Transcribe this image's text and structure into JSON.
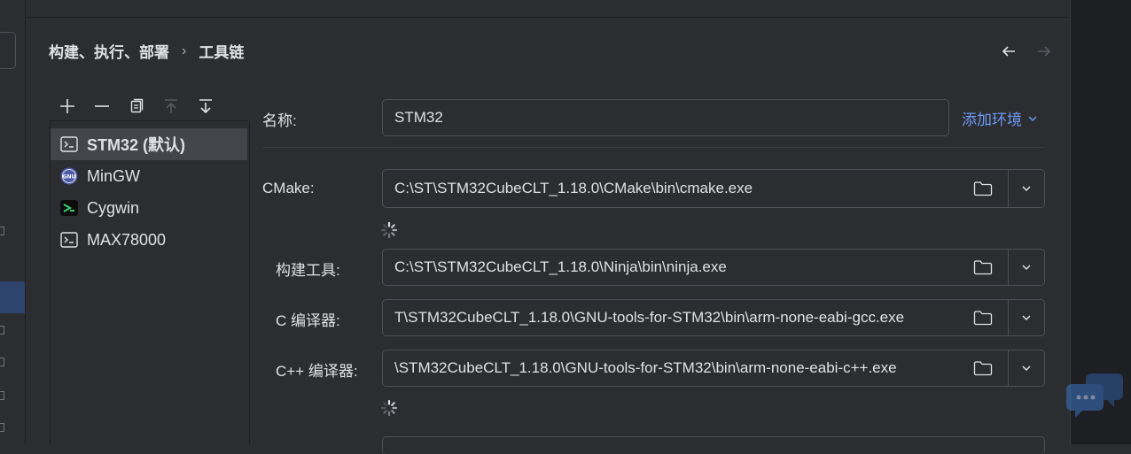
{
  "breadcrumb": {
    "parent": "构建、执行、部署",
    "current": "工具链"
  },
  "toolbar": [
    "add-icon",
    "remove-icon",
    "copy-icon",
    "move-up-icon",
    "move-down-icon"
  ],
  "toolchains": [
    {
      "label": "STM32 (默认)",
      "icon": "terminal-icon",
      "selected": true
    },
    {
      "label": "MinGW",
      "icon": "gnu-icon",
      "selected": false
    },
    {
      "label": "Cygwin",
      "icon": "cygwin-icon",
      "selected": false
    },
    {
      "label": "MAX78000",
      "icon": "terminal-icon",
      "selected": false
    }
  ],
  "form": {
    "name_label": "名称:",
    "name_value": "STM32",
    "add_env": "添加环境",
    "cmake_label": "CMake:",
    "cmake_value": "C:\\ST\\STM32CubeCLT_1.18.0\\CMake\\bin\\cmake.exe",
    "build_tool_label": "构建工具:",
    "build_tool_value": "C:\\ST\\STM32CubeCLT_1.18.0\\Ninja\\bin\\ninja.exe",
    "c_compiler_label": "C 编译器:",
    "c_compiler_value": "T\\STM32CubeCLT_1.18.0\\GNU-tools-for-STM32\\bin\\arm-none-eabi-gcc.exe",
    "cpp_compiler_label": "C++ 编译器:",
    "cpp_compiler_value": "\\STM32CubeCLT_1.18.0\\GNU-tools-for-STM32\\bin\\arm-none-eabi-c++.exe"
  },
  "colors": {
    "background": "#2b2d30",
    "border": "#4e5157",
    "link": "#6d9bf5",
    "selection": "#43454a"
  }
}
